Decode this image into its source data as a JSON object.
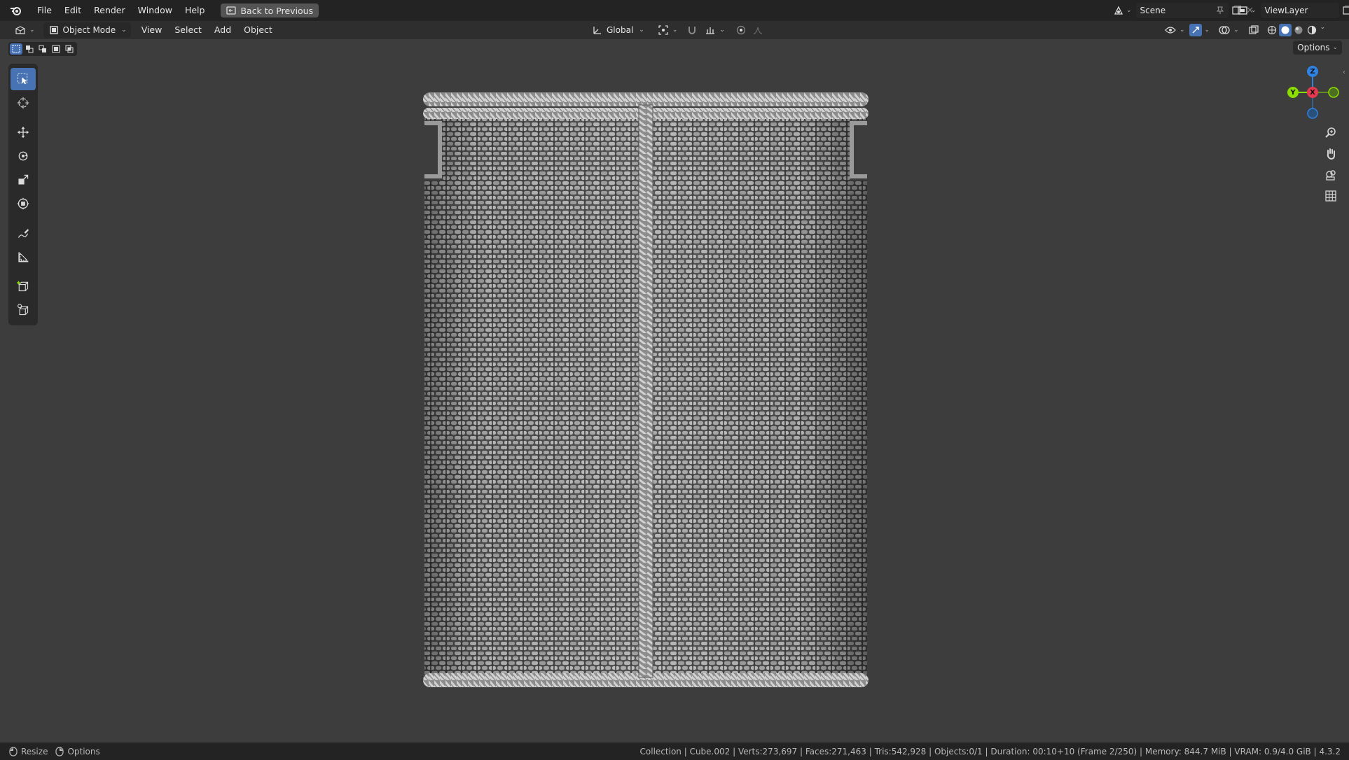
{
  "topbar": {
    "menu": [
      "File",
      "Edit",
      "Render",
      "Window",
      "Help"
    ],
    "back_button": "Back to Previous",
    "scene": "Scene",
    "view_layer": "ViewLayer"
  },
  "header": {
    "mode": "Object Mode",
    "menus": [
      "View",
      "Select",
      "Add",
      "Object"
    ],
    "transform_orientation": "Global"
  },
  "viewport": {
    "options_label": "Options",
    "gizmo": {
      "z": "Z",
      "y": "Y",
      "x": "X"
    }
  },
  "colors": {
    "accent": "#4772b3",
    "axis_x": "#e8384f",
    "axis_y": "#8bdc00",
    "axis_z": "#2f83e3"
  },
  "statusbar": {
    "resize": "Resize",
    "options": "Options",
    "info": "Collection | Cube.002 | Verts:273,697 | Faces:271,463 | Tris:542,928 | Objects:0/1 | Duration: 00:10+10 (Frame 2/250) | Memory: 844.7 MiB | VRAM: 0.9/4.0 GiB | 4.3.2"
  }
}
